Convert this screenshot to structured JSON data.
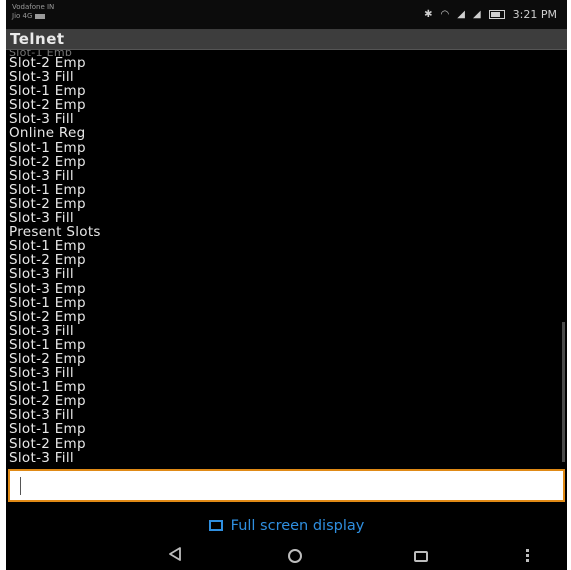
{
  "statusbar": {
    "carrier_line1": "Vodafone IN",
    "carrier_line2": "Jio 4G",
    "time": "3:21 PM",
    "icons": [
      "bluetooth-icon",
      "wifi-icon",
      "signal-icon",
      "signal-icon",
      "battery-icon"
    ]
  },
  "app": {
    "title": "Telnet"
  },
  "terminal": {
    "partial_top": "Slot-1 Emp",
    "lines": [
      "Slot-2 Emp",
      "Slot-3 Fill",
      "Slot-1 Emp",
      "Slot-2 Emp",
      "Slot-3 Fill",
      "Online Reg",
      "Slot-1 Emp",
      "Slot-2 Emp",
      "Slot-3 Fill",
      "Slot-1 Emp",
      "Slot-2 Emp",
      "Slot-3 Fill",
      "Present Slots",
      "Slot-1 Emp",
      "Slot-2 Emp",
      "Slot-3 Fill",
      "Slot-3 Emp",
      "Slot-1 Emp",
      "Slot-2 Emp",
      "Slot-3 Fill",
      "Slot-1 Emp",
      "Slot-2 Emp",
      "Slot-3 Fill",
      "Slot-1 Emp",
      "Slot-2 Emp",
      "Slot-3 Fill",
      "Slot-1 Emp",
      "Slot-2 Emp",
      "Slot-3 Fill"
    ]
  },
  "input": {
    "value": "",
    "placeholder": ""
  },
  "footer": {
    "fullscreen_label": "Full screen display"
  },
  "navbar": {
    "icons": [
      "back-icon",
      "home-icon",
      "recent-apps-icon",
      "menu-icon"
    ]
  },
  "colors": {
    "accent": "#e08a16",
    "link": "#2f8fe0",
    "background": "#000000"
  }
}
